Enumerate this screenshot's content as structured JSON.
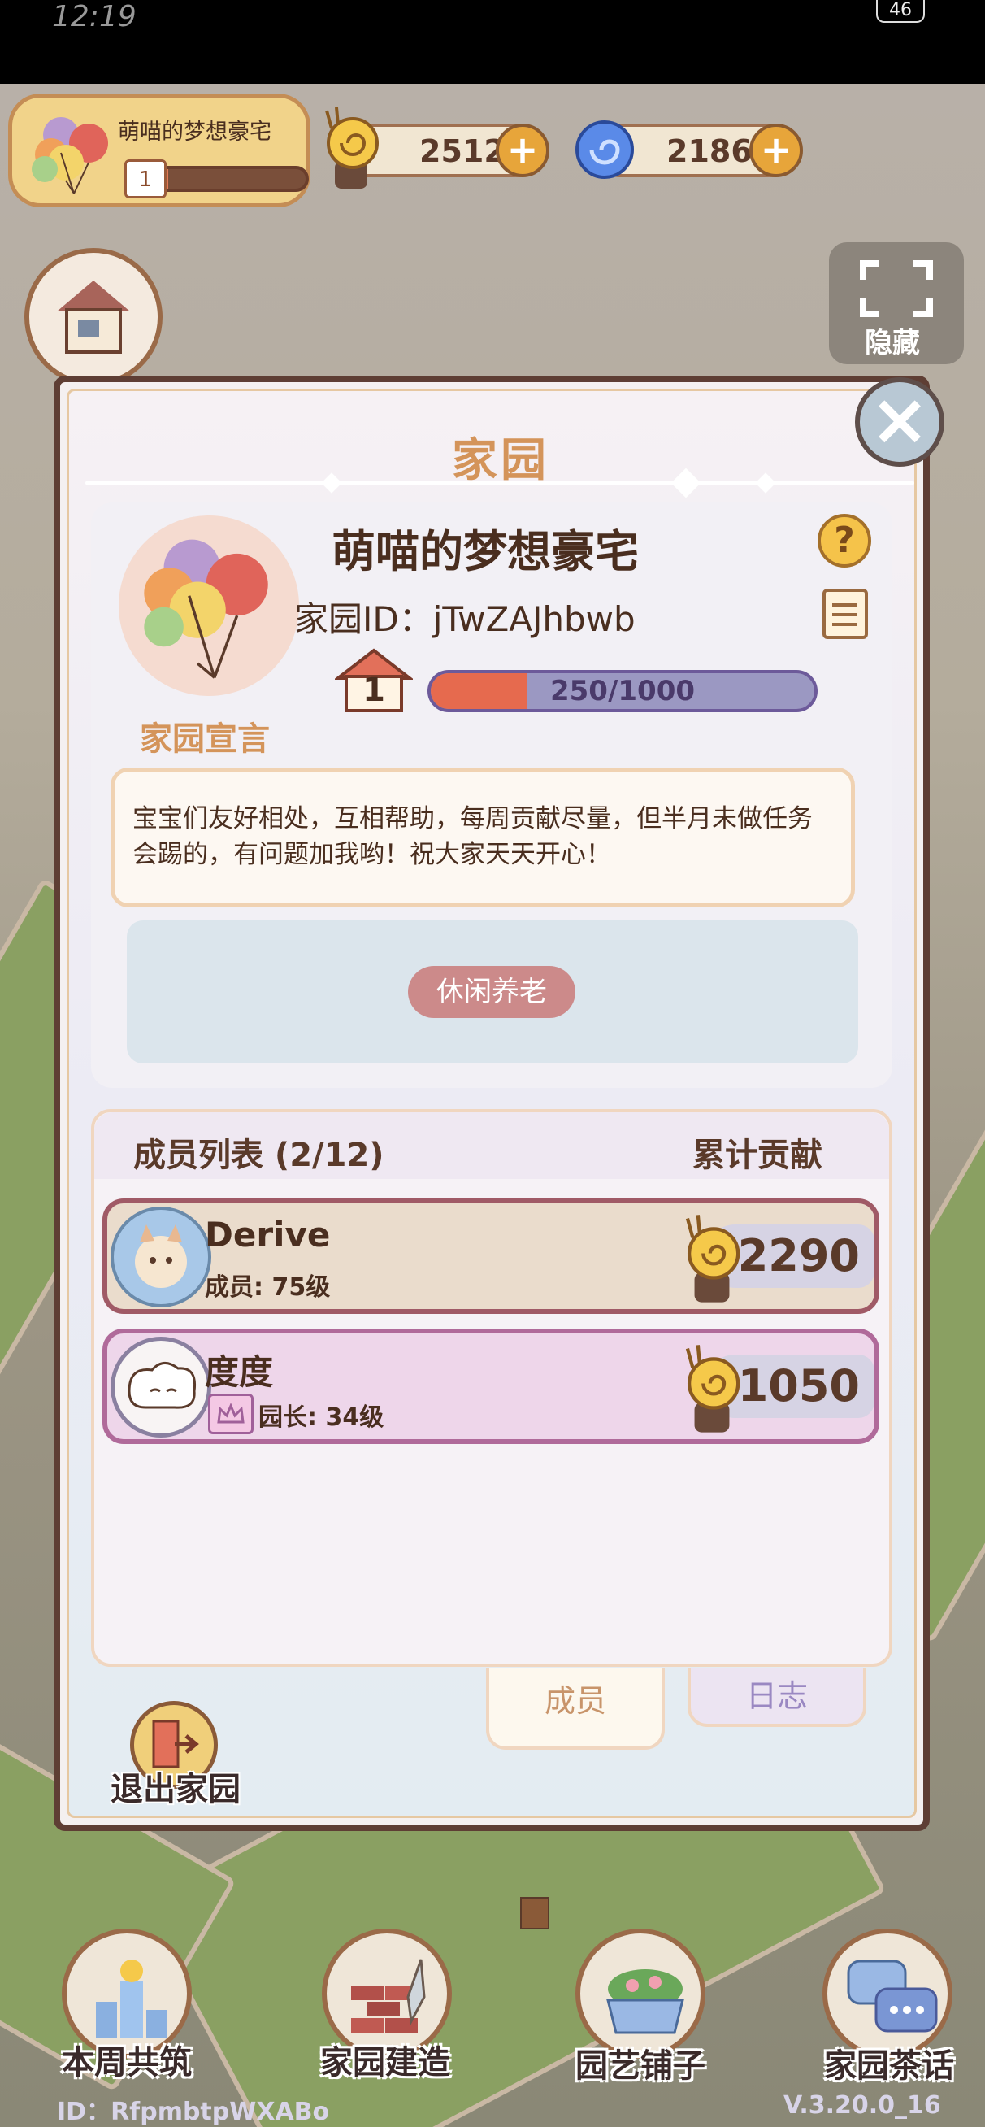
{
  "status": {
    "time": "12:19",
    "network": "46"
  },
  "hud": {
    "home_name": "萌喵的梦想豪宅",
    "home_level": "1",
    "home_level_progress": 0.22,
    "coins": "25125",
    "gems": "2186",
    "hide_label": "隐藏"
  },
  "modal": {
    "title": "家园",
    "name": "萌喵的梦想豪宅",
    "id_text": "家园ID：jTwZAJhbwb",
    "level": "1",
    "progress_text": "250/1000",
    "progress_fraction": 0.25,
    "manifesto_label": "家园宣言",
    "manifesto": "宝宝们友好相处，互相帮助，每周贡献尽量，但半月未做任务会踢的，有问题加我哟！祝大家天天开心！",
    "tag": "休闲养老",
    "members_title": "成员列表 (2/12)",
    "contrib_title": "累计贡献",
    "members": [
      {
        "name": "Derive",
        "role": "成员: 75级",
        "score": "2290"
      },
      {
        "name": "度度",
        "role": "园长: 34级",
        "score": "1050"
      }
    ],
    "tabs": [
      {
        "label": "成员"
      },
      {
        "label": "日志"
      }
    ],
    "exit_label": "退出家园"
  },
  "bottom_bar": [
    {
      "label": "本周共筑"
    },
    {
      "label": "家园建造"
    },
    {
      "label": "园艺铺子"
    },
    {
      "label": "家园茶话"
    }
  ],
  "footer": {
    "id": "ID：RfpmbtpWXABo",
    "version": "V.3.20.0_16"
  },
  "colors": {
    "accent": "#d4945a",
    "progress": "#e66a4e",
    "modal_border": "#5e3e34"
  }
}
